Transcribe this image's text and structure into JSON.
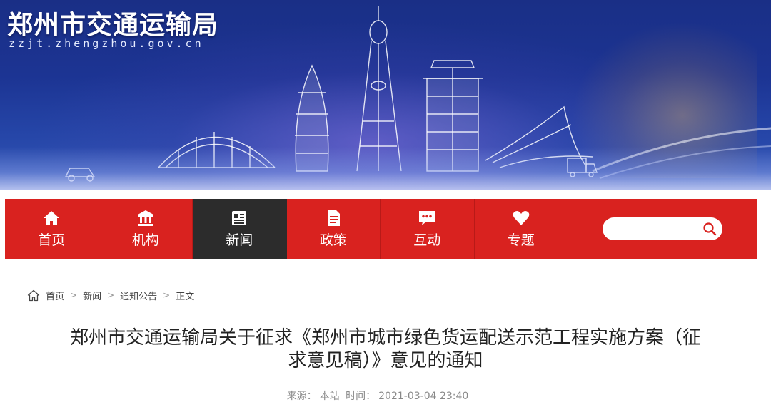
{
  "header": {
    "site_title": "郑州市交通运输局",
    "site_domain": "zzjt.zhengzhou.gov.cn"
  },
  "nav": {
    "items": [
      {
        "label": "首页",
        "icon": "home-icon"
      },
      {
        "label": "机构",
        "icon": "institution-icon"
      },
      {
        "label": "新闻",
        "icon": "news-icon",
        "active": true
      },
      {
        "label": "政策",
        "icon": "document-icon"
      },
      {
        "label": "互动",
        "icon": "chat-icon"
      },
      {
        "label": "专题",
        "icon": "heart-icon"
      }
    ],
    "search": {
      "placeholder": "",
      "value": ""
    }
  },
  "breadcrumb": [
    "首页",
    "新闻",
    "通知公告",
    "正文"
  ],
  "article": {
    "title_line1": "郑州市交通运输局关于征求《郑州市城市绿色货运配送示范工程实施方案（征",
    "title_line2": "求意见稿）》意见的通知",
    "source_label": "来源：",
    "source": "本站",
    "time_label": "时间：",
    "time": "2021-03-04 23:40"
  },
  "colors": {
    "nav_red": "#d9221f",
    "nav_active": "#2c2c2c",
    "banner_blue": "#1c3493"
  }
}
